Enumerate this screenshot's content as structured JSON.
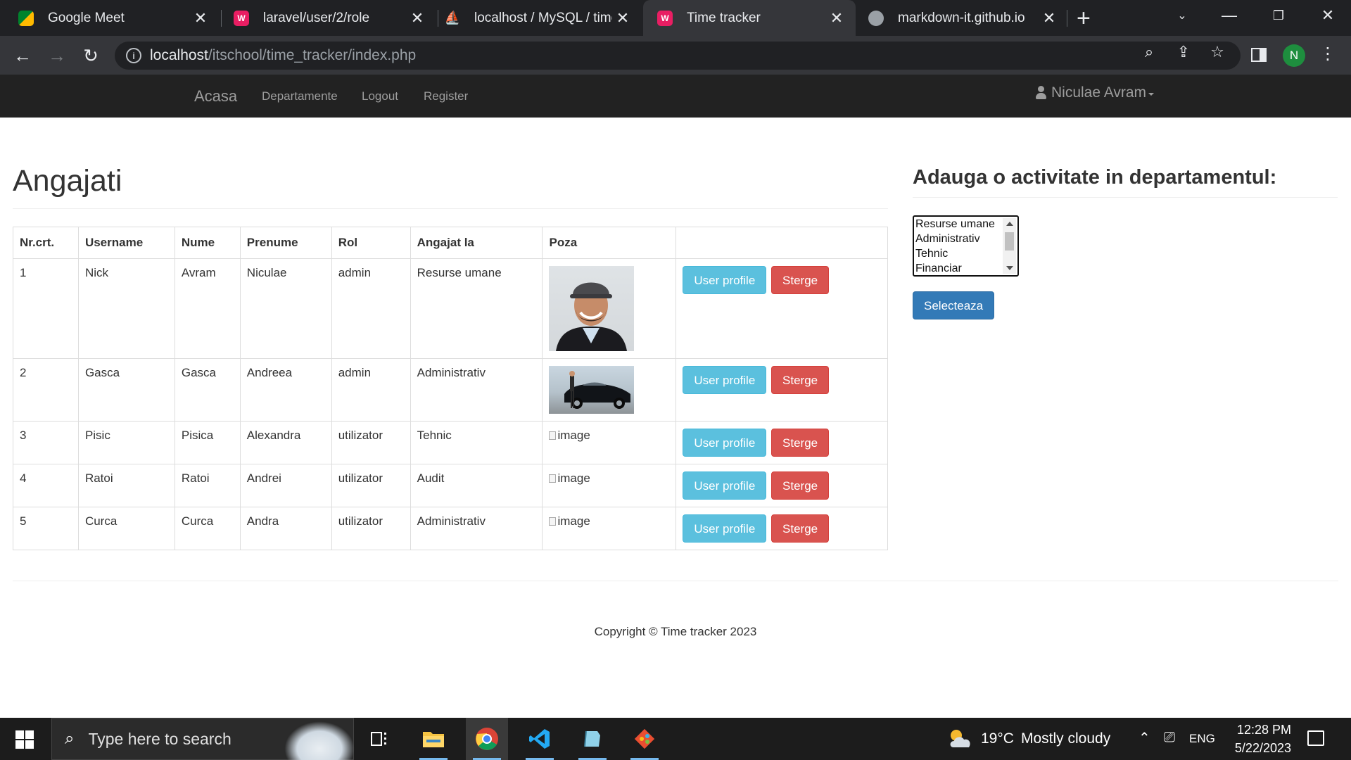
{
  "browser": {
    "tabs": [
      {
        "label": "Google Meet",
        "active": false
      },
      {
        "label": "laravel/user/2/role",
        "active": false
      },
      {
        "label": "localhost / MySQL / time_",
        "active": false
      },
      {
        "label": "Time tracker",
        "active": true
      },
      {
        "label": "markdown-it.github.io",
        "active": false
      }
    ],
    "close_glyph": "✕",
    "new_tab_glyph": "+",
    "url_host": "localhost",
    "url_path": "/itschool/time_tracker/index.php",
    "profile_initial": "N"
  },
  "navbar": {
    "brand": "Acasa",
    "links": [
      "Departamente",
      "Logout",
      "Register"
    ],
    "user_name": "Niculae Avram"
  },
  "main": {
    "title": "Angajati",
    "table": {
      "headers": [
        "Nr.crt.",
        "Username",
        "Nume",
        "Prenume",
        "Rol",
        "Angajat la",
        "Poza",
        ""
      ],
      "rows": [
        {
          "nr": "1",
          "username": "Nick",
          "nume": "Avram",
          "prenume": "Niculae",
          "rol": "admin",
          "angajat_la": "Resurse umane",
          "poza": "photo"
        },
        {
          "nr": "2",
          "username": "Gasca",
          "nume": "Gasca",
          "prenume": "Andreea",
          "rol": "admin",
          "angajat_la": "Administrativ",
          "poza": "photo"
        },
        {
          "nr": "3",
          "username": "Pisic",
          "nume": "Pisica",
          "prenume": "Alexandra",
          "rol": "utilizator",
          "angajat_la": "Tehnic",
          "poza": "image"
        },
        {
          "nr": "4",
          "username": "Ratoi",
          "nume": "Ratoi",
          "prenume": "Andrei",
          "rol": "utilizator",
          "angajat_la": "Audit",
          "poza": "image"
        },
        {
          "nr": "5",
          "username": "Curca",
          "nume": "Curca",
          "prenume": "Andra",
          "rol": "utilizator",
          "angajat_la": "Administrativ",
          "poza": "image"
        }
      ],
      "profile_button": "User profile",
      "delete_button": "Sterge",
      "broken_image_alt": "image"
    }
  },
  "sidebar": {
    "title": "Adauga o activitate in departamentul:",
    "options": [
      "Resurse umane",
      "Administrativ",
      "Tehnic",
      "Financiar"
    ],
    "submit_label": "Selecteaza"
  },
  "footer": {
    "copyright": "Copyright © Time tracker 2023"
  },
  "taskbar": {
    "search_placeholder": "Type here to search",
    "weather_temp": "19°C",
    "weather_desc": "Mostly cloudy",
    "language": "ENG",
    "time": "12:28 PM",
    "date": "5/22/2023"
  },
  "colors": {
    "info": "#5bc0de",
    "danger": "#d9534f",
    "primary": "#337ab7",
    "navbar": "#222222"
  }
}
